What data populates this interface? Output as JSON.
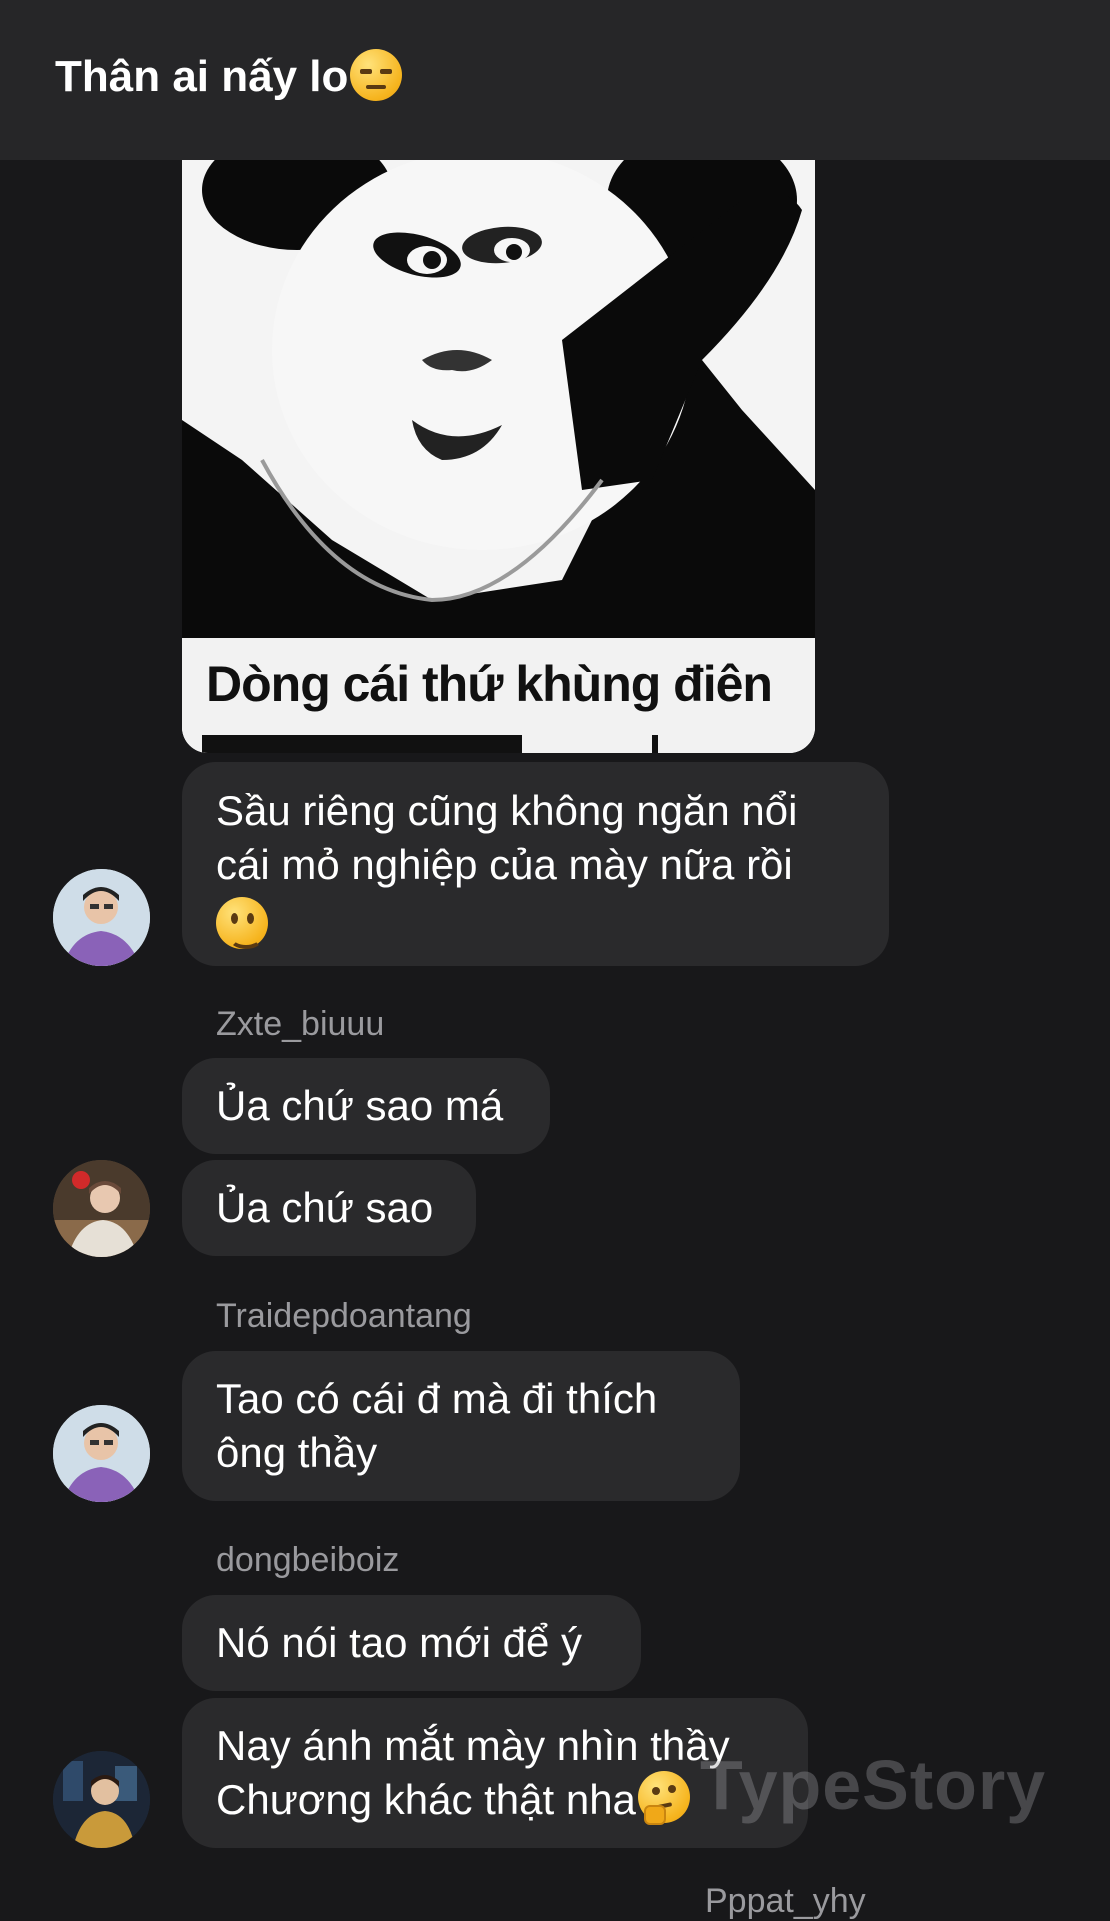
{
  "header": {
    "title": "Thân ai nấy lo",
    "title_emoji": "unamused-face-icon"
  },
  "sticker": {
    "caption": "Dòng cái thứ khùng điên"
  },
  "messages": [
    {
      "text": "Sầu riêng cũng không ngăn nổi\ncái mỏ nghiệp của mày nữa rồi",
      "emoji": "slightly-smiling-face-icon"
    },
    {
      "sender": "Zxte_biuuu"
    },
    {
      "text": "Ủa chứ sao má"
    },
    {
      "text": "Ủa chứ sao"
    },
    {
      "sender": "Traidepdoantang"
    },
    {
      "text": "Tao có cái đ mà đi thích\nông thầy"
    },
    {
      "sender": "dongbeiboiz"
    },
    {
      "text": "Nó nói tao mới để ý"
    },
    {
      "text": "Nay ánh mắt mày nhìn thầy\nChương khác thật nha",
      "emoji": "thinking-face-icon"
    },
    {
      "sender": "Pppat_yhy"
    }
  ],
  "watermark": "TypeStory",
  "colors": {
    "background": "#18181a",
    "header": "#262628",
    "bubble": "#2a2a2c",
    "sender": "#9a9a9e"
  }
}
